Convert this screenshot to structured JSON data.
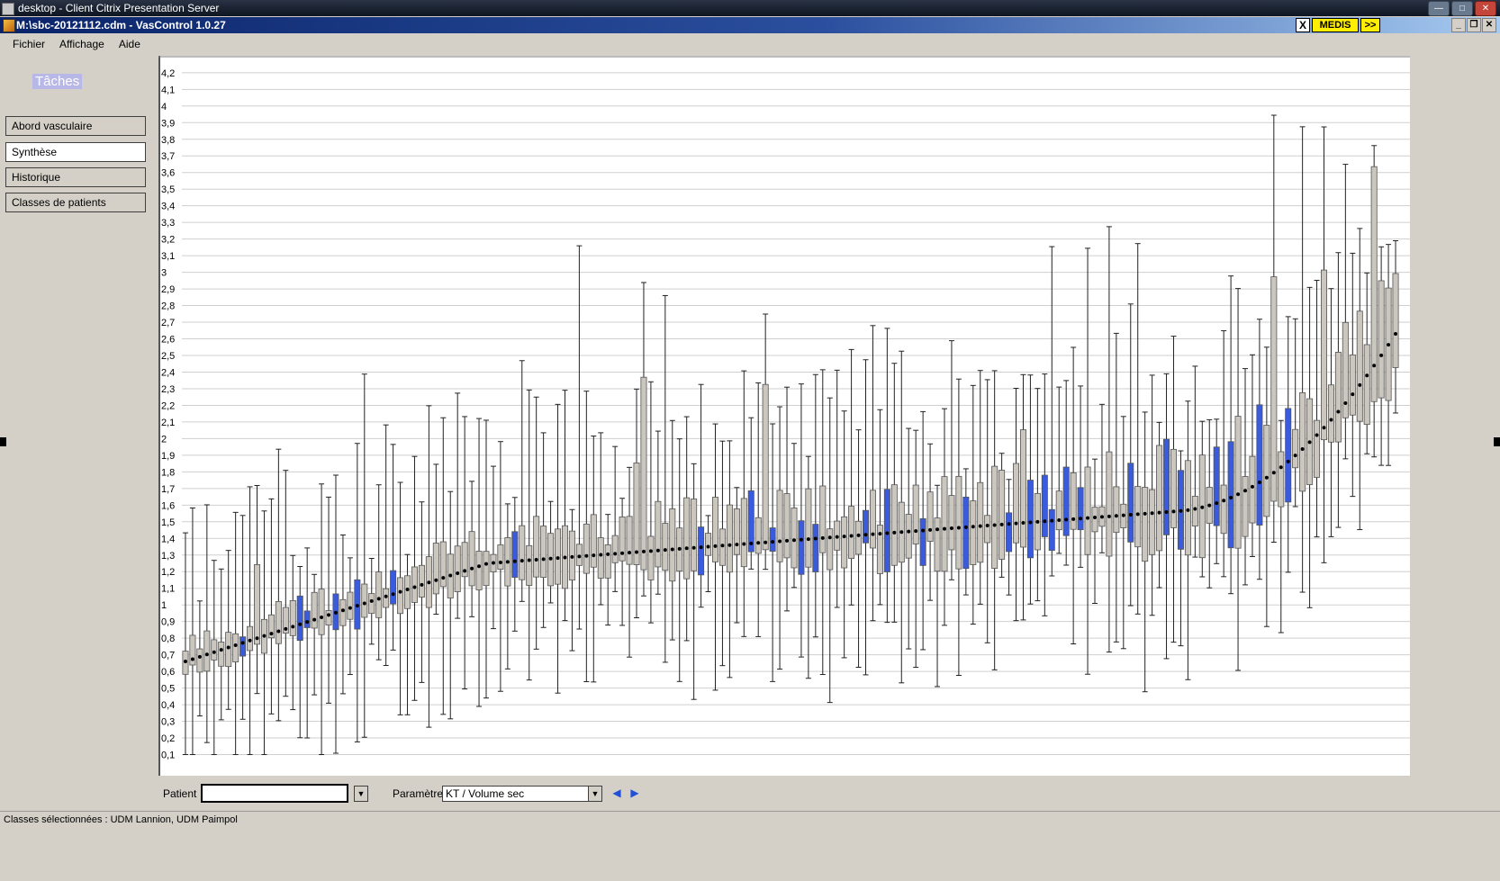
{
  "window": {
    "outer_title": "desktop - Client Citrix Presentation Server",
    "app_title": "M:\\sbc-20121112.cdm - VasControl 1.0.27",
    "medis_close": "X",
    "medis_label": "MEDIS",
    "medis_arrow": ">>"
  },
  "menu": [
    "Fichier",
    "Affichage",
    "Aide"
  ],
  "sidebar": {
    "title": "Tâches",
    "items": [
      {
        "label": "Abord vasculaire",
        "active": false
      },
      {
        "label": "Synthèse",
        "active": true
      },
      {
        "label": "Historique",
        "active": false
      },
      {
        "label": "Classes de patients",
        "active": false
      }
    ]
  },
  "colors": {
    "box_gray": "#cbc7bf",
    "box_blue": "#3a5bdb",
    "median_dot": "#000000",
    "grid": "#cfcfcf"
  },
  "chart_data": {
    "type": "boxplot",
    "title": "",
    "xlabel": "",
    "ylabel": "",
    "ylim": [
      0,
      4.3
    ],
    "ytick_labels": [
      "0,1",
      "0,2",
      "0,3",
      "0,4",
      "0,5",
      "0,6",
      "0,7",
      "0,8",
      "0,9",
      "1",
      "1,1",
      "1,2",
      "1,3",
      "1,4",
      "1,5",
      "1,6",
      "1,7",
      "1,8",
      "1,9",
      "2",
      "2,1",
      "2,2",
      "2,3",
      "2,4",
      "2,5",
      "2,6",
      "2,7",
      "2,8",
      "2,9",
      "3",
      "3,1",
      "3,2",
      "3,3",
      "3,4",
      "3,5",
      "3,6",
      "3,7",
      "3,8",
      "3,9",
      "4",
      "4,1",
      "4,2"
    ],
    "ytick_values": [
      0.1,
      0.2,
      0.3,
      0.4,
      0.5,
      0.6,
      0.7,
      0.8,
      0.9,
      1.0,
      1.1,
      1.2,
      1.3,
      1.4,
      1.5,
      1.6,
      1.7,
      1.8,
      1.9,
      2.0,
      2.1,
      2.2,
      2.3,
      2.4,
      2.5,
      2.6,
      2.7,
      2.8,
      2.9,
      3.0,
      3.1,
      3.2,
      3.3,
      3.4,
      3.5,
      3.6,
      3.7,
      3.8,
      3.9,
      4.0,
      4.1,
      4.2
    ],
    "grid": true,
    "series_count_estimate": 170,
    "median_start": 0.66,
    "median_end": 2.7,
    "highlighted_indices": [
      8,
      16,
      17,
      21,
      24,
      29,
      46,
      72,
      79,
      82,
      86,
      88,
      95,
      98,
      103,
      109,
      115,
      118,
      120,
      121,
      123,
      125,
      132,
      137,
      139,
      144,
      146,
      150,
      154
    ],
    "note_values": "approximate readings; medians rise monotonically from ~0.66 to ~2.7"
  },
  "bottom": {
    "patient_label": "Patient",
    "patient_value": "",
    "param_label": "Paramètre",
    "param_value": "KT / Volume sec",
    "prev_arrow": "◀",
    "next_arrow": "▶",
    "dropdown_glyph": "▼"
  },
  "status": "Classes sélectionnées : UDM Lannion, UDM Paimpol"
}
